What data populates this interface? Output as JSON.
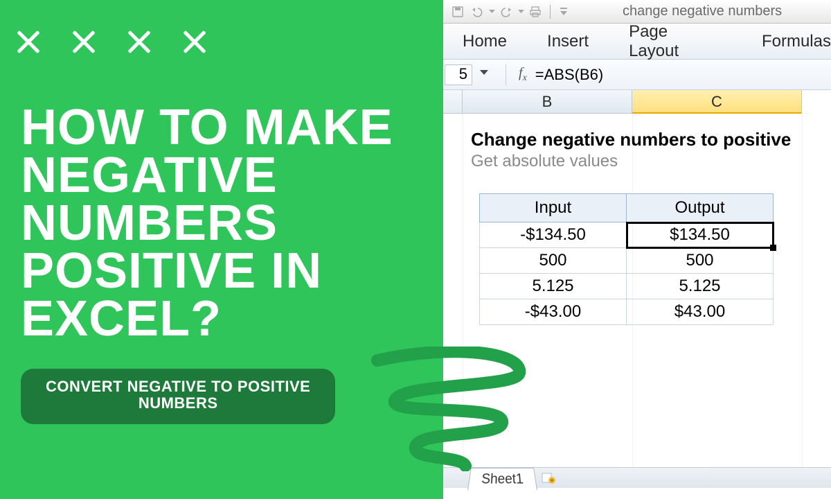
{
  "left": {
    "headline": "HOW TO MAKE NEGATIVE NUMBERS POSITIVE IN EXCEL?",
    "subtitle_l1": "CONVERT NEGATIVE TO POSITIVE",
    "subtitle_l2": "NUMBERS"
  },
  "excel": {
    "window_title": "change negative numbers",
    "ribbon": {
      "tabs": [
        "Home",
        "Insert",
        "Page Layout",
        "Formulas"
      ]
    },
    "namebox": "5",
    "formula": "=ABS(B6)",
    "columns": [
      "B",
      "C"
    ],
    "body_title": "Change negative numbers to positive",
    "body_subtitle": "Get absolute values",
    "headers": [
      "Input",
      "Output"
    ],
    "rows": [
      {
        "input": "-$134.50",
        "output": "$134.50",
        "in_neg": true,
        "selected": true
      },
      {
        "input": "500",
        "output": "500",
        "in_neg": false,
        "selected": false
      },
      {
        "input": "5.125",
        "output": "5.125",
        "in_neg": false,
        "selected": false
      },
      {
        "input": "-$43.00",
        "output": "$43.00",
        "in_neg": true,
        "selected": false
      }
    ],
    "sheet_tab": "Sheet1"
  },
  "colors": {
    "brand_green": "#2FC55A",
    "pill_green": "#1E7A3A",
    "negative": "#E02020",
    "header_fill": "#E9F0F8"
  }
}
